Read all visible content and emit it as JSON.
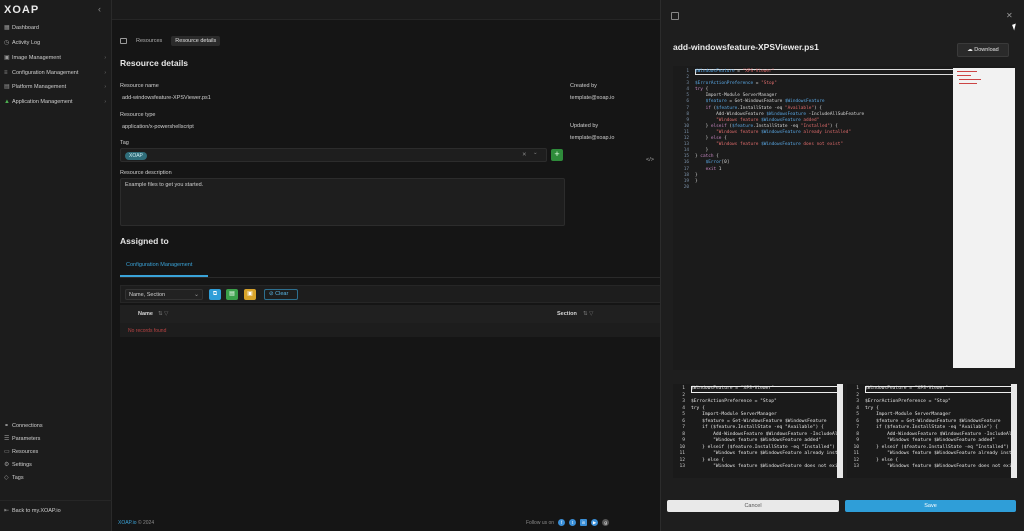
{
  "app": {
    "logo": "XOAP"
  },
  "sidebar": {
    "items": [
      {
        "label": "Dashboard",
        "icon": "grid-icon"
      },
      {
        "label": "Activity Log",
        "icon": "clock-icon"
      },
      {
        "label": "Image Management",
        "icon": "image-icon",
        "chevron": "›"
      },
      {
        "label": "Configuration Management",
        "icon": "sliders-icon",
        "chevron": "›"
      },
      {
        "label": "Platform Management",
        "icon": "server-icon",
        "chevron": "›"
      },
      {
        "label": "Application Management",
        "icon": "triangle-icon",
        "chevron": "›"
      }
    ],
    "bottom_items": [
      {
        "label": "Connections",
        "icon": "link-icon"
      },
      {
        "label": "Parameters",
        "icon": "list-icon"
      },
      {
        "label": "Resources",
        "icon": "folder-icon"
      },
      {
        "label": "Settings",
        "icon": "gear-icon"
      },
      {
        "label": "Tags",
        "icon": "tag-icon"
      }
    ],
    "back_link": "Back to my.XOAP.io"
  },
  "breadcrumb": {
    "items": [
      "Resources",
      "Resource details"
    ]
  },
  "details": {
    "section_title": "Resource details",
    "resource_name_label": "Resource name",
    "resource_name": "add-windowsfeature-XPSViewer.ps1",
    "resource_type_label": "Resource type",
    "resource_type": "application/x-powershellscript",
    "tag_label": "Tag",
    "tag_value": "XOAP",
    "description_label": "Resource description",
    "description": "Example files to get you started.",
    "created_by_label": "Created by",
    "created_by": "template@xoap.io",
    "updated_by_label": "Updated by",
    "updated_by": "template@xoap.io",
    "add_label": "+",
    "clear_x": "✕",
    "tag_caret": "⌄"
  },
  "assigned": {
    "title": "Assigned to",
    "tab": "Configuration Management",
    "filter_select": "Name, Section",
    "clear_label": "Clear",
    "col_name": "Name",
    "col_section": "Section",
    "empty_text": "No records found"
  },
  "footer": {
    "copyright_brand": "XOAP.io",
    "copyright_year": "© 2024",
    "follow": "Follow us on"
  },
  "drawer": {
    "title": "add-windowsfeature-XPSViewer.ps1",
    "download_label": "Download",
    "cancel_label": "Cancel",
    "save_label": "Save",
    "close": "✕"
  },
  "code": {
    "line_numbers": "1\n2\n3\n4\n5\n6\n7\n8\n9\n10\n11\n12\n13\n14\n15\n16\n17\n18\n19\n20",
    "diff_line_numbers": "1\n2\n3\n4\n5\n6\n7\n8\n9\n10\n11\n12\n13",
    "diff_text": "$WindowsFeature = \"XPS-Viewer\"\n\n$ErrorActionPreference = \"Stop\"\ntry {\n    Import-Module ServerManager\n    $feature = Get-WindowsFeature $WindowsFeature\n    if ($feature.InstallState -eq \"Available\") {\n        Add-WindowsFeature $WindowsFeature -IncludeAllSubFeature\n        \"Windows feature $WindowsFeature added\"\n    } elseif ($feature.InstallState -eq \"Installed\") {\n        \"Windows feature $WindowsFeature already installed\"\n    } else {\n        \"Windows feature $WindowsFeature does not exist\""
  },
  "colors": {
    "accent": "#3aa3d8",
    "save": "#2f9ed8",
    "add": "#2e8b3a",
    "tag": "#2f6d7a",
    "error": "#b94343"
  }
}
